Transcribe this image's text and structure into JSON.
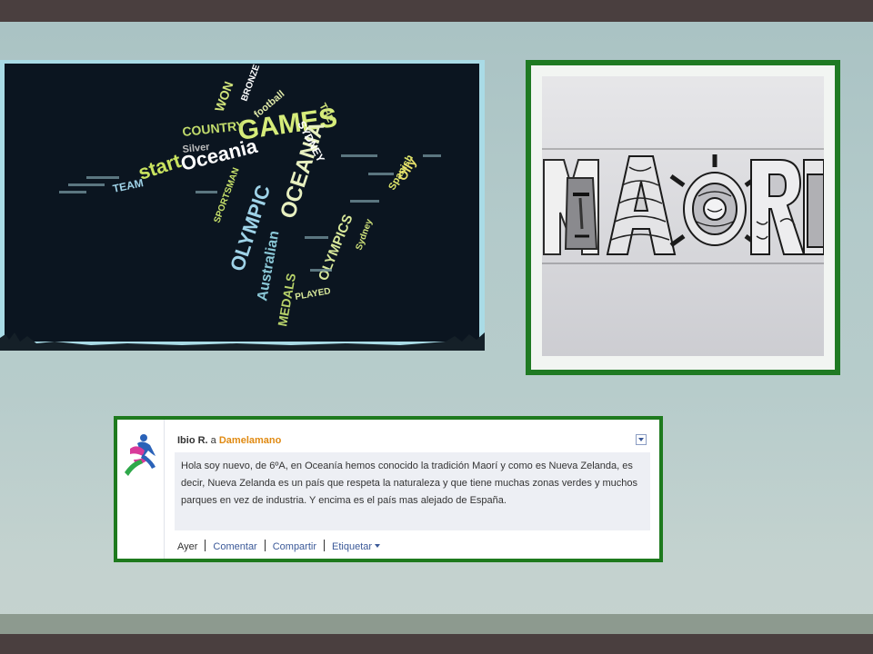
{
  "left_image": {
    "words": [
      "GAMES",
      "OLYMPIC",
      "OCEANIA",
      "Oceania",
      "start",
      "Australian",
      "OLYMPICS",
      "MEDALS",
      "COUNTRY",
      "SYDNEY",
      "THE",
      "Spanish",
      "TEAM",
      "WON",
      "football",
      "Silver",
      "SPORTSMAN",
      "PLAYED",
      "Sydney",
      "Olly",
      "BRONZE"
    ]
  },
  "right_image": {},
  "post": {
    "author": "Ibio R.",
    "separator": "a",
    "target": "Damelamano",
    "body": "Hola soy nuevo, de 6ºA, en Oceanía hemos conocido la tradición Maorí y como es Nueva Zelanda, es decir, Nueva Zelanda es un país que respeta la naturaleza y que tiene muchas zonas verdes y muchos parques en vez de industria. Y encima es el país mas alejado de España.",
    "time": "Ayer",
    "actions": {
      "comment": "Comentar",
      "share": "Compartir",
      "tag": "Etiquetar"
    }
  }
}
